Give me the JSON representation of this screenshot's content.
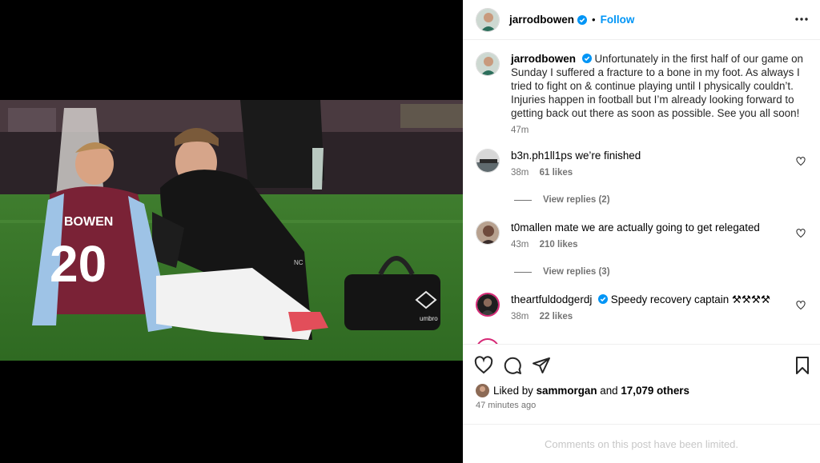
{
  "post": {
    "author": "jarrodbowen",
    "follow_label": "Follow",
    "dot": "•",
    "caption": "Unfortunately in the first half of our game on Sunday I suffered a fracture to a bone in my foot. As always I tried to fight on & continue playing until I physically couldn’t. Injuries happen in football but I’m already looking forward to getting back out there as soon as possible. See you all soon!",
    "caption_time": "47m",
    "photo": {
      "jersey_name": "BOWEN",
      "jersey_number": "20",
      "jacket_initials": "NC",
      "bag_brand": "umbro"
    }
  },
  "comments": [
    {
      "user": "b3n.ph1ll1ps",
      "text": "we’re finished",
      "time": "38m",
      "likes": "61 likes",
      "view_replies": "View replies (2)"
    },
    {
      "user": "t0mallen",
      "text": "mate we are actually going to get relegated",
      "time": "43m",
      "likes": "210 likes",
      "view_replies": "View replies (3)"
    },
    {
      "user": "theartfuldodgerdj",
      "text": "Speedy recovery captain",
      "emoji": "⚒⚒⚒⚒",
      "time": "38m",
      "likes": "22 likes"
    }
  ],
  "likes": {
    "prefix": "Liked by",
    "user": "sammorgan",
    "joiner": "and",
    "others": "17,079 others"
  },
  "post_time": "47 minutes ago",
  "comments_limited": "Comments on this post have been limited.",
  "colors": {
    "accent": "#0095f6",
    "verified": "#0095f6",
    "muted": "#737373"
  },
  "icons": [
    "more-icon",
    "heart-icon",
    "comment-icon",
    "share-icon",
    "save-icon",
    "verified-icon"
  ]
}
